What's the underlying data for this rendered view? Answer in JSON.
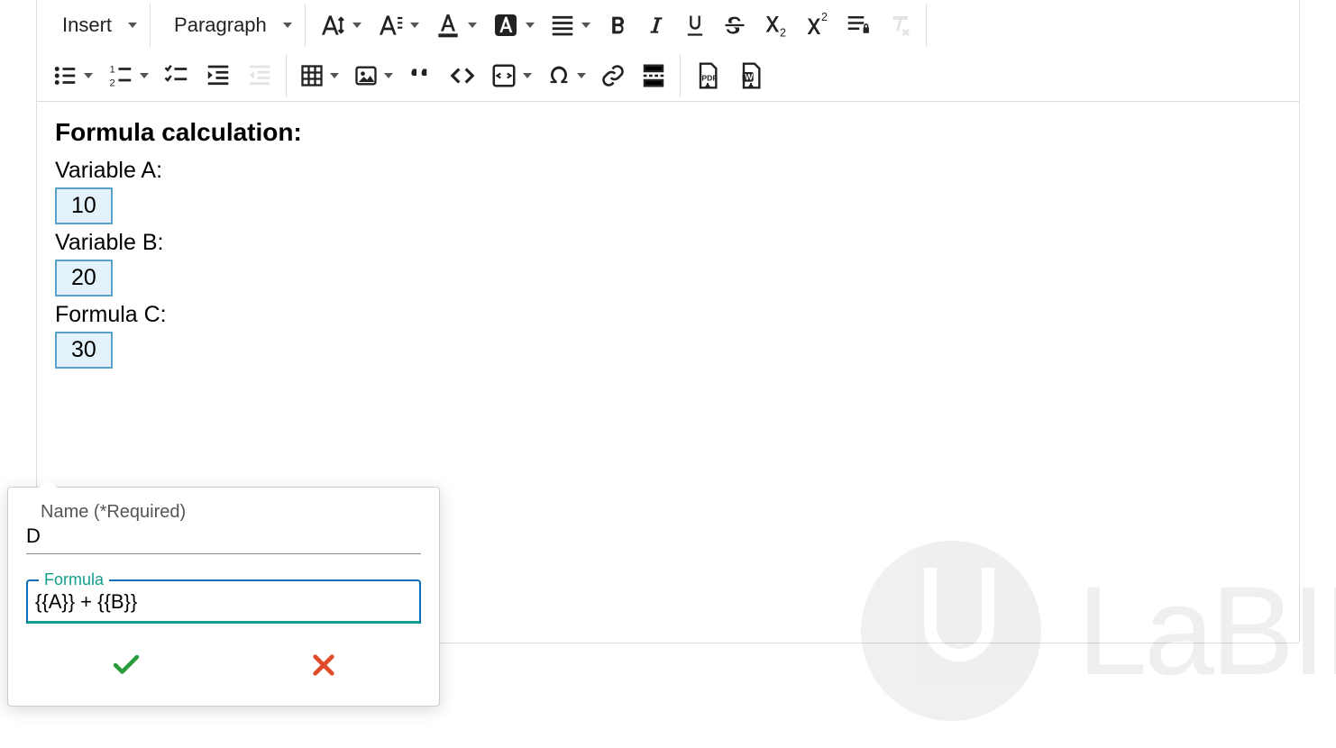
{
  "toolbar": {
    "insert_label": "Insert",
    "paragraph_label": "Paragraph"
  },
  "document": {
    "heading": "Formula calculation:",
    "var_a_label": "Variable A:",
    "var_a_value": "10",
    "var_b_label": "Variable B:",
    "var_b_value": "20",
    "formula_c_label": "Formula C:",
    "formula_c_value": "30"
  },
  "popup": {
    "name_label": "Name (*Required)",
    "name_value": "D",
    "formula_label": "Formula",
    "formula_value": "{{A}} + {{B}}"
  },
  "watermark": {
    "text": "LaBII"
  }
}
